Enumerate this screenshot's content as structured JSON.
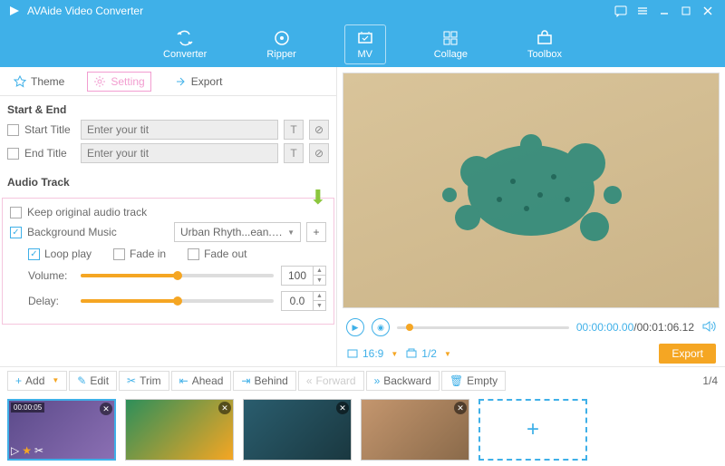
{
  "app": {
    "title": "AVAide Video Converter"
  },
  "nav": {
    "converter": "Converter",
    "ripper": "Ripper",
    "mv": "MV",
    "collage": "Collage",
    "toolbox": "Toolbox"
  },
  "tabs": {
    "theme": "Theme",
    "setting": "Setting",
    "export": "Export"
  },
  "startend": {
    "heading": "Start & End",
    "start": "Start Title",
    "end": "End Title",
    "placeholder": "Enter your tit"
  },
  "audio": {
    "heading": "Audio Track",
    "keep": "Keep original audio track",
    "bgm": "Background Music",
    "bgm_value": "Urban Rhyth...ean.amr.amr",
    "loop": "Loop play",
    "fadein": "Fade in",
    "fadeout": "Fade out",
    "vol_label": "Volume:",
    "vol_value": "100",
    "delay_label": "Delay:",
    "delay_value": "0.0"
  },
  "player": {
    "cur": "00:00:00.00",
    "total": "00:01:06.12",
    "aspect": "16:9",
    "page": "1/2"
  },
  "export_btn": "Export",
  "toolbar": {
    "add": "Add",
    "edit": "Edit",
    "trim": "Trim",
    "ahead": "Ahead",
    "behind": "Behind",
    "forward": "Forward",
    "backward": "Backward",
    "empty": "Empty"
  },
  "pager": "1/4",
  "thumbs": {
    "dur1": "00:00:05"
  }
}
